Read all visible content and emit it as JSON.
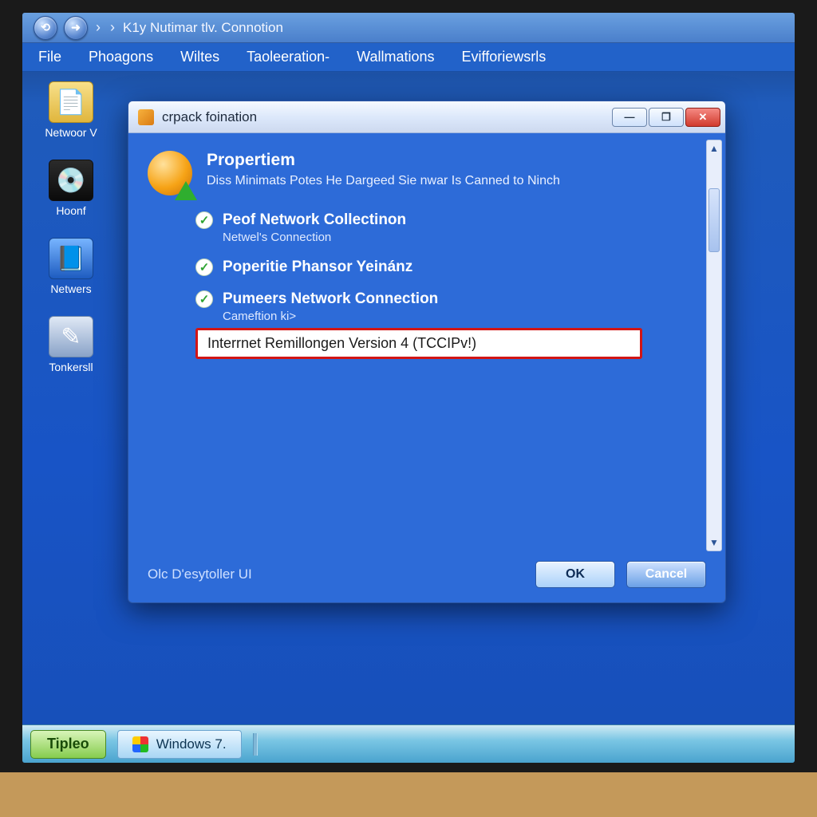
{
  "address_bar": {
    "path_text": "K1y Nutimar tlv. Connotion"
  },
  "menubar": {
    "items": [
      "File",
      "Phoagons",
      "Wiltes",
      "Taoleeration-",
      "Wallmations",
      "Evifforiewsrls"
    ]
  },
  "desktop": {
    "icons": [
      {
        "label": "Netwoor V"
      },
      {
        "label": "Hoonf"
      },
      {
        "label": "Netwers"
      },
      {
        "label": "Tonkersll"
      }
    ]
  },
  "dialog": {
    "title": "crpack foination",
    "header": {
      "title": "Propertiem",
      "subtitle": "Diss Minimats Potes He Dargeed Sie nwar Is Canned to Ninch"
    },
    "items": [
      {
        "title": "Peof Network Collectinon",
        "sub": "Netwel's Connection"
      },
      {
        "title": "Poperitie Phansor Yeinánz",
        "sub": ""
      },
      {
        "title": "Pumeers Network Connection",
        "sub": "Cameftion ki>"
      }
    ],
    "highlight": "Interrnet Remillongen Version 4 (TCCIPv!)",
    "install_link": "Olc D'esytoller UI",
    "buttons": {
      "ok": "OK",
      "cancel": "Cancel"
    }
  },
  "taskbar": {
    "start": "Tipleo",
    "task": "Windows 7."
  }
}
